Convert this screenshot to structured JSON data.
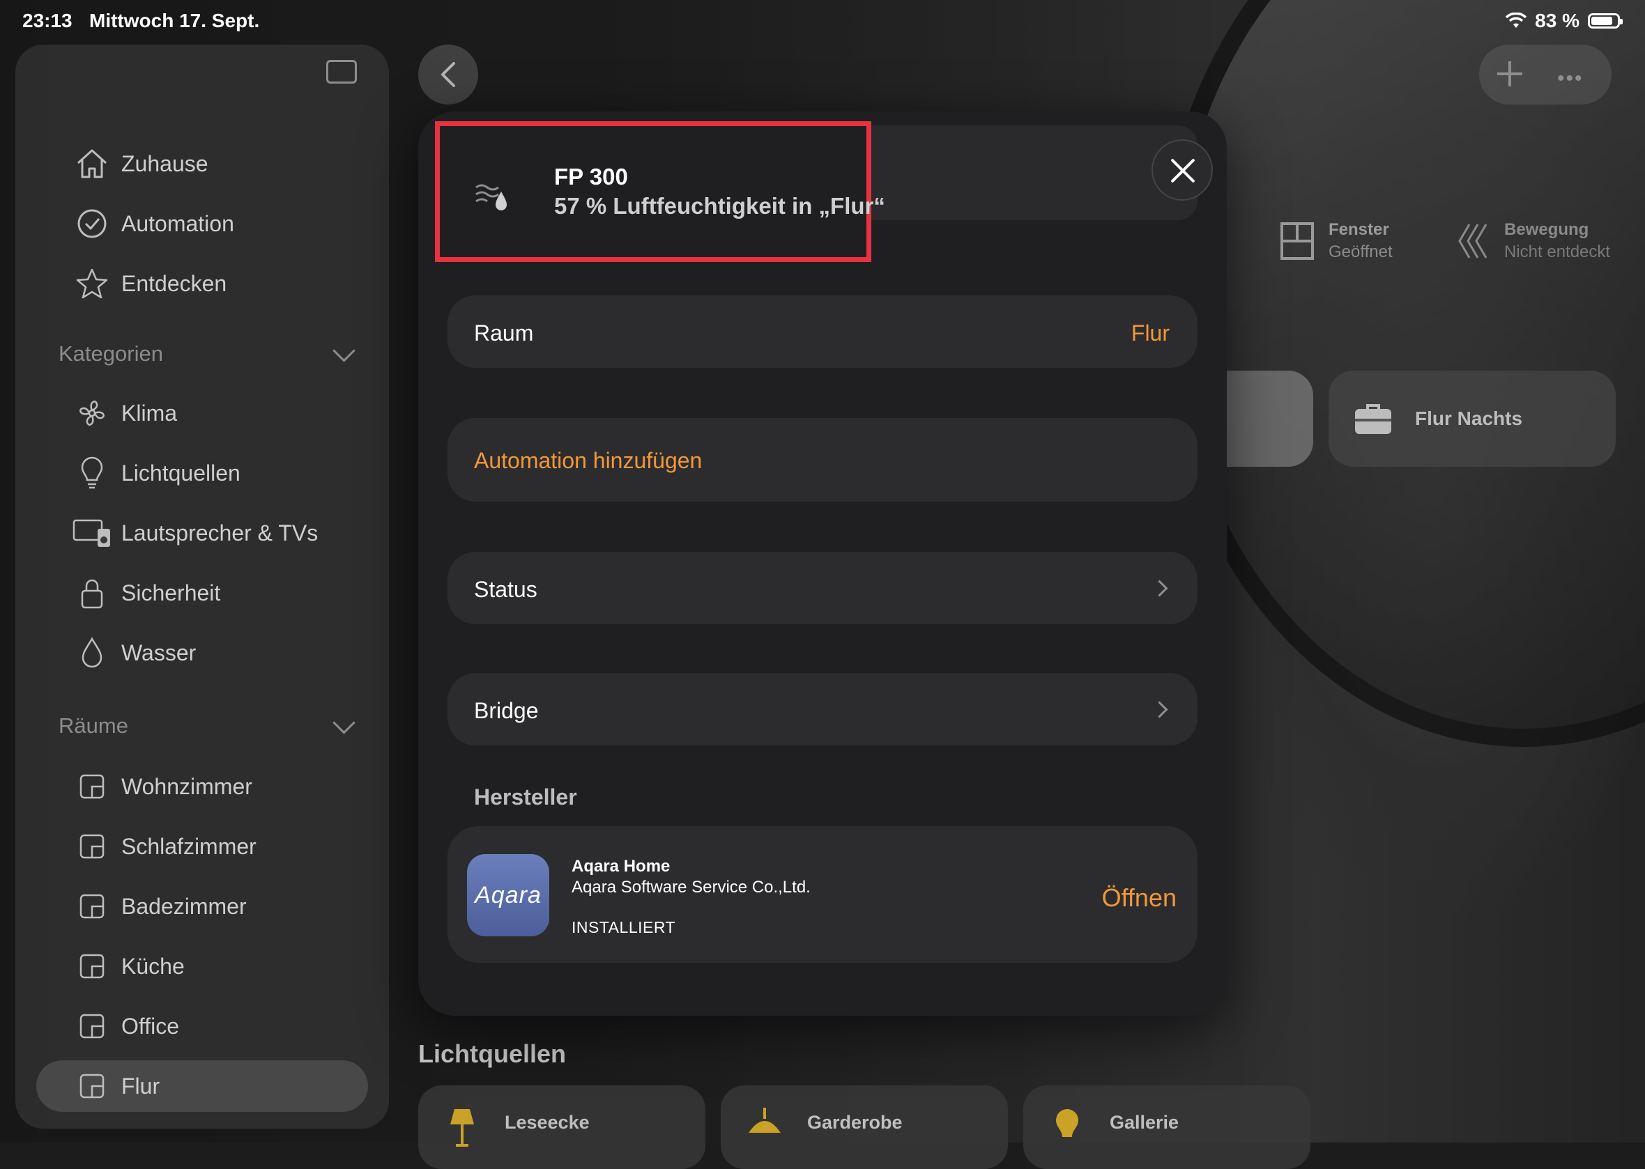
{
  "status_bar": {
    "time": "23:13",
    "date": "Mittwoch 17. Sept.",
    "battery": "83 %",
    "battery_level": 0.83
  },
  "sidebar": {
    "main_items": [
      {
        "label": "Zuhause",
        "icon": "house-icon"
      },
      {
        "label": "Automation",
        "icon": "clock-check-icon"
      },
      {
        "label": "Entdecken",
        "icon": "star-icon"
      }
    ],
    "categories_header": "Kategorien",
    "categories": [
      {
        "label": "Klima",
        "icon": "fan-icon"
      },
      {
        "label": "Lichtquellen",
        "icon": "lightbulb-icon"
      },
      {
        "label": "Lautsprecher & TVs",
        "icon": "speaker-tv-icon"
      },
      {
        "label": "Sicherheit",
        "icon": "lock-icon"
      },
      {
        "label": "Wasser",
        "icon": "drop-icon"
      }
    ],
    "rooms_header": "Räume",
    "rooms": [
      {
        "label": "Wohnzimmer"
      },
      {
        "label": "Schlafzimmer"
      },
      {
        "label": "Badezimmer"
      },
      {
        "label": "Küche"
      },
      {
        "label": "Office"
      },
      {
        "label": "Flur",
        "selected": true
      }
    ]
  },
  "background": {
    "status_tiles": [
      {
        "title": "Fenster",
        "value": "Geöffnet",
        "icon": "window-icon"
      },
      {
        "title": "Bewegung",
        "value": "Nicht entdeckt",
        "icon": "motion-icon"
      }
    ],
    "scene_tile": {
      "label": "Flur Nachts",
      "icon": "briefcase-icon"
    },
    "lights_header": "Lichtquellen",
    "lights": [
      {
        "label": "Leseecke",
        "icon": "floor-lamp-icon"
      },
      {
        "label": "Garderobe",
        "icon": "ceiling-lamp-icon"
      },
      {
        "label": "Gallerie",
        "icon": "bulb-icon"
      }
    ]
  },
  "modal": {
    "device_name": "FP 300",
    "device_status": "57 % Luftfeuchtigkeit in „Flur“",
    "room_label": "Raum",
    "room_value": "Flur",
    "add_automation": "Automation hinzufügen",
    "status_label": "Status",
    "bridge_label": "Bridge",
    "manufacturer_header": "Hersteller",
    "app": {
      "icon_text": "Aqara",
      "name": "Aqara Home",
      "developer": "Aqara Software Service Co.,Ltd.",
      "state": "INSTALLIERT",
      "open_label": "Öffnen"
    }
  },
  "colors": {
    "accent": "#f0983a",
    "highlight": "#e8323f"
  }
}
